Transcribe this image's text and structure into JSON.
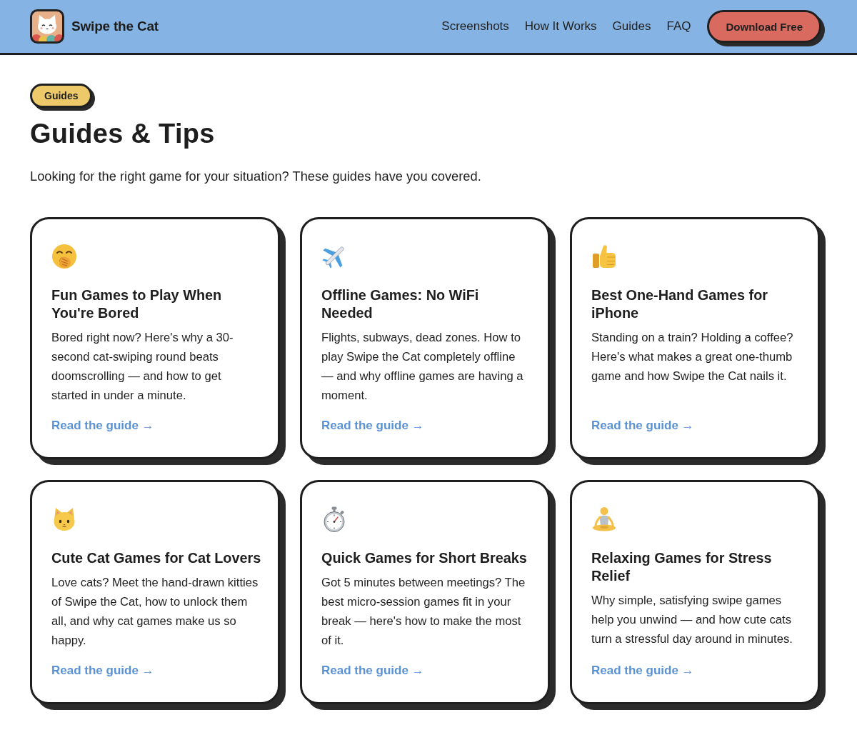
{
  "header": {
    "brand": "Swipe the Cat",
    "nav": [
      "Screenshots",
      "How It Works",
      "Guides",
      "FAQ"
    ],
    "cta": "Download Free"
  },
  "intro": {
    "badge": "Guides",
    "title": "Guides & Tips",
    "text": "Looking for the right game for your situation? These guides have you covered."
  },
  "guides": [
    {
      "title": "Fun Games to Play When You're Bored",
      "description": "Bored right now? Here's why a 30-second cat-swiping round beats doomscrolling — and how to get started in under a minute.",
      "link": "Read the guide →"
    },
    {
      "title": "Offline Games: No WiFi Needed",
      "description": "Flights, subways, dead zones. How to play Swipe the Cat completely offline — and why offline games are having a moment.",
      "link": "Read the guide →"
    },
    {
      "title": "Best One-Hand Games for iPhone",
      "description": "Standing on a train? Holding a coffee? Here's what makes a great one-thumb game and how Swipe the Cat nails it.",
      "link": "Read the guide →"
    },
    {
      "title": "Cute Cat Games for Cat Lovers",
      "description": "Love cats? Meet the hand-drawn kitties of Swipe the Cat, how to unlock them all, and why cat games make us so happy.",
      "link": "Read the guide →"
    },
    {
      "title": "Quick Games for Short Breaks",
      "description": "Got 5 minutes between meetings? The best micro-session games fit in your break — here's how to make the most of it.",
      "link": "Read the guide →"
    },
    {
      "title": "Relaxing Games for Stress Relief",
      "description": "Why simple, satisfying swipe games help you unwind — and how cute cats turn a stressful day around in minutes.",
      "link": "Read the guide →"
    }
  ]
}
